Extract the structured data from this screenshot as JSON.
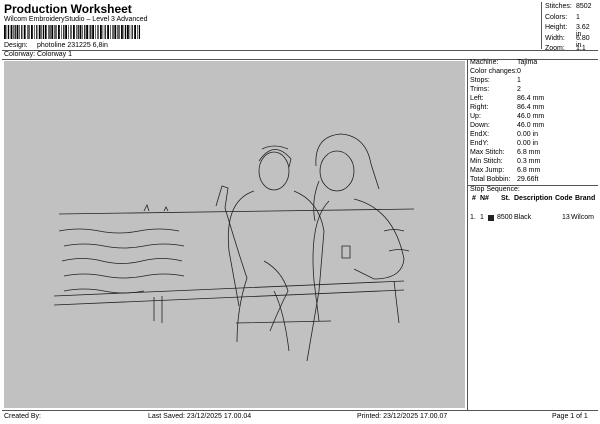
{
  "header": {
    "title": "Production Worksheet",
    "software": "Wilcom EmbroideryStudio – Level 3 Advanced",
    "design_label": "Design:",
    "design_value": "photoline 231225 6,8in",
    "colorway_label": "Colorway:",
    "colorway_value": "Colorway 1"
  },
  "stats": [
    {
      "label": "Stitches:",
      "value": "8502"
    },
    {
      "label": "Colors:",
      "value": "1"
    },
    {
      "label": "Height:",
      "value": "3.62 in"
    },
    {
      "label": "Width:",
      "value": "6.80 in"
    },
    {
      "label": "Zoom:",
      "value": "1:1"
    }
  ],
  "machine": [
    {
      "label": "Machine:",
      "value": "Tajima"
    },
    {
      "label": "Color changes:",
      "value": "0"
    },
    {
      "label": "Stops:",
      "value": "1"
    },
    {
      "label": "Trims:",
      "value": "2"
    },
    {
      "label": "Left:",
      "value": "86.4 mm"
    },
    {
      "label": "Right:",
      "value": "86.4 mm"
    },
    {
      "label": "Up:",
      "value": "46.0 mm"
    },
    {
      "label": "Down:",
      "value": "46.0 mm"
    },
    {
      "label": "EndX:",
      "value": "0.00 in"
    },
    {
      "label": "EndY:",
      "value": "0.00 in"
    },
    {
      "label": "Max Stitch:",
      "value": "6.8 mm"
    },
    {
      "label": "Min Stitch:",
      "value": "0.3 mm"
    },
    {
      "label": "Max Jump:",
      "value": "6.8 mm"
    },
    {
      "label": "Total Bobbin:",
      "value": "29.66ft"
    }
  ],
  "sequence": {
    "title": "Stop Sequence:",
    "columns": [
      "#",
      "N#",
      "St.",
      "Description",
      "Code",
      "Brand"
    ],
    "rows": [
      {
        "num": "1.",
        "n": "1",
        "swatch": "#222222",
        "st": "8500",
        "description": "Black",
        "code": "13",
        "brand": "Wilcom"
      }
    ]
  },
  "footer": {
    "created": "Created By:",
    "saved": "Last Saved: 23/12/2025 17.00.04",
    "printed": "Printed: 23/12/2025 17.00.07",
    "page": "Page 1 of 1"
  }
}
